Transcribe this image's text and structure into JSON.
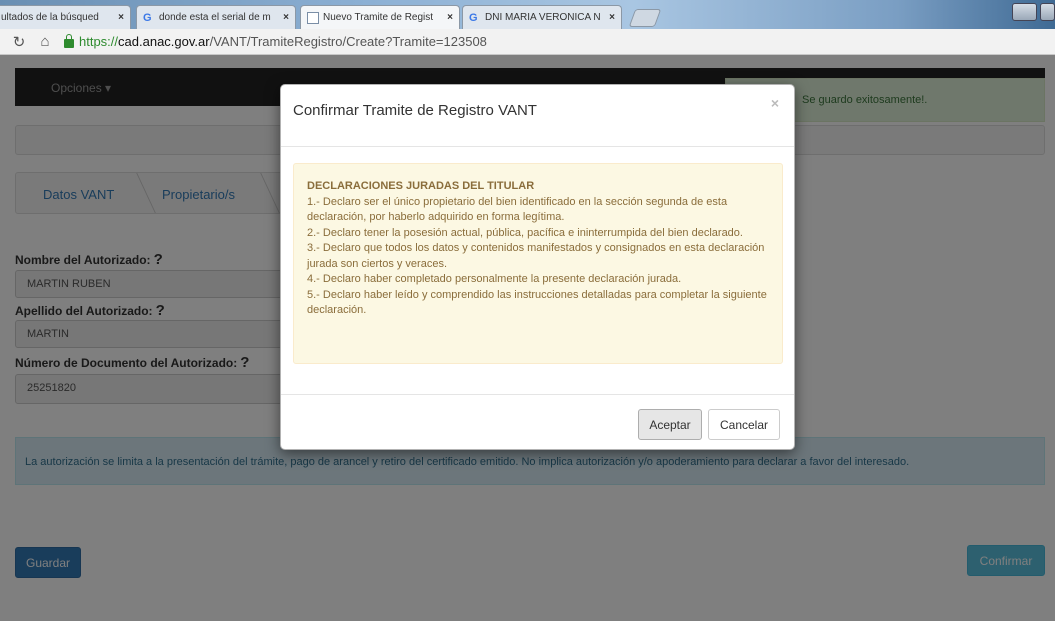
{
  "browser": {
    "tabs": [
      {
        "label": "ultados de la búsqued",
        "icon": "document-icon",
        "active": false
      },
      {
        "label": "donde esta el serial de m",
        "icon": "google-icon",
        "active": false
      },
      {
        "label": "Nuevo Tramite de Regist",
        "icon": "document-icon",
        "active": true
      },
      {
        "label": "DNI MARIA VERONICA N",
        "icon": "google-icon",
        "active": false
      }
    ],
    "tab_close_glyph": "×",
    "url": {
      "scheme": "https://",
      "host": "cad.anac.gov.ar",
      "path": "/VANT/TramiteRegistro/Create?Tramite=123508"
    }
  },
  "page": {
    "navbar_menu": "Opciones ▾",
    "success_message": "Se guardo exitosamente!.",
    "wizard_steps": [
      "Datos VANT",
      "Propietario/s"
    ],
    "fields": [
      {
        "label": "Nombre del Autorizado:",
        "help": "?",
        "value": "MARTIN RUBEN"
      },
      {
        "label": "Apellido del Autorizado:",
        "help": "?",
        "value": "MARTIN"
      },
      {
        "label": "Número de Documento del Autorizado:",
        "help": "?",
        "value": "25251820"
      }
    ],
    "info_message": "La autorización se limita a la presentación del trámite, pago de arancel y retiro del certificado emitido. No implica autorización y/o apoderamiento para declarar a favor del interesado.",
    "guardar_label": "Guardar",
    "confirmar_label": "Confirmar"
  },
  "modal": {
    "title": "Confirmar Tramite de Registro VANT",
    "close_glyph": "×",
    "declarations_title": "DECLARACIONES JURADAS DEL TITULAR",
    "declarations": [
      "1.- Declaro ser el único propietario del bien identificado en la sección segunda de esta declaración, por haberlo adquirido en forma legítima.",
      "2.- Declaro tener la posesión actual, pública, pacífica e ininterrumpida del bien declarado.",
      "3.- Declaro que todos los datos y contenidos manifestados y consignados en esta declaración jurada son ciertos y veraces.",
      "4.- Declaro haber completado personalmente la presente declaración jurada.",
      "5.- Declaro haber leído y comprendido las instrucciones detalladas para completar la siguiente declaración."
    ],
    "accept_label": "Aceptar",
    "cancel_label": "Cancelar"
  },
  "colors": {
    "navbar": "#222222",
    "primary": "#337ab7",
    "info": "#5bc0de",
    "warning_bg": "#fcf8e3",
    "warning_text": "#8a6d3b"
  }
}
